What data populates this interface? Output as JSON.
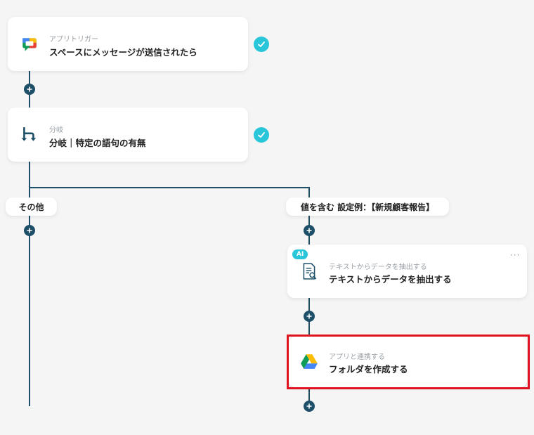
{
  "trigger": {
    "sub": "アプリトリガー",
    "main": "スペースにメッセージが送信されたら",
    "icon": "google-chat-icon"
  },
  "branch": {
    "sub": "分岐",
    "main": "分岐｜特定の語句の有無",
    "icon": "branch-icon"
  },
  "branch_labels": {
    "left": "その他",
    "right": "値を含む 設定例：【新規顧客報告】"
  },
  "extract": {
    "badge": "AI",
    "sub": "テキストからデータを抽出する",
    "main": "テキストからデータを抽出する",
    "icon": "document-search-icon",
    "more": "···"
  },
  "drive": {
    "sub": "アプリと連携する",
    "main": "フォルダを作成する",
    "icon": "google-drive-icon"
  },
  "colors": {
    "line": "#1e4f68",
    "check": "#28c6d8",
    "highlight": "#e0141e",
    "ai_badge": "#28c6d8"
  }
}
